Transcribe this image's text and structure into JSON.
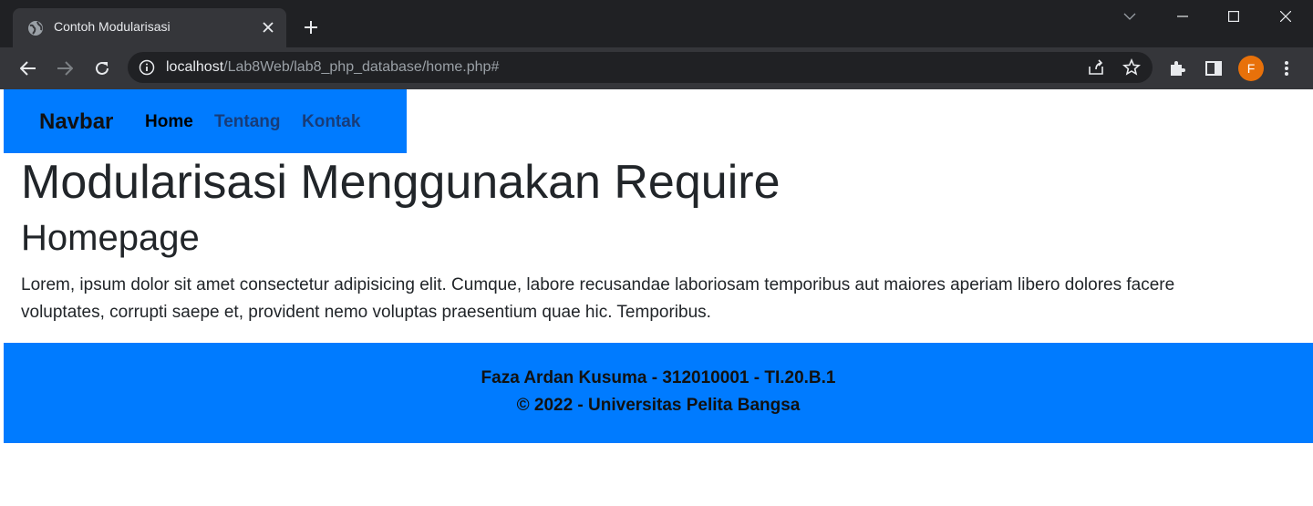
{
  "browser": {
    "tab_title": "Contoh Modularisasi",
    "url_host": "localhost",
    "url_path": "/Lab8Web/lab8_php_database/home.php#",
    "profile_initial": "F",
    "profile_color": "#e8710a"
  },
  "navbar": {
    "brand": "Navbar",
    "links": [
      {
        "label": "Home"
      },
      {
        "label": "Tentang"
      },
      {
        "label": "Kontak"
      }
    ],
    "background": "#007bff"
  },
  "main": {
    "title": "Modularisasi Menggunakan Require",
    "subtitle": "Homepage",
    "body": "Lorem, ipsum dolor sit amet consectetur adipisicing elit. Cumque, labore recusandae laboriosam temporibus aut maiores aperiam libero dolores facere voluptates, corrupti saepe et, provident nemo voluptas praesentium quae hic. Temporibus."
  },
  "footer": {
    "line1": "Faza Ardan Kusuma - 312010001 - TI.20.B.1",
    "line2": "© 2022 - Universitas Pelita Bangsa",
    "background": "#007bff"
  }
}
